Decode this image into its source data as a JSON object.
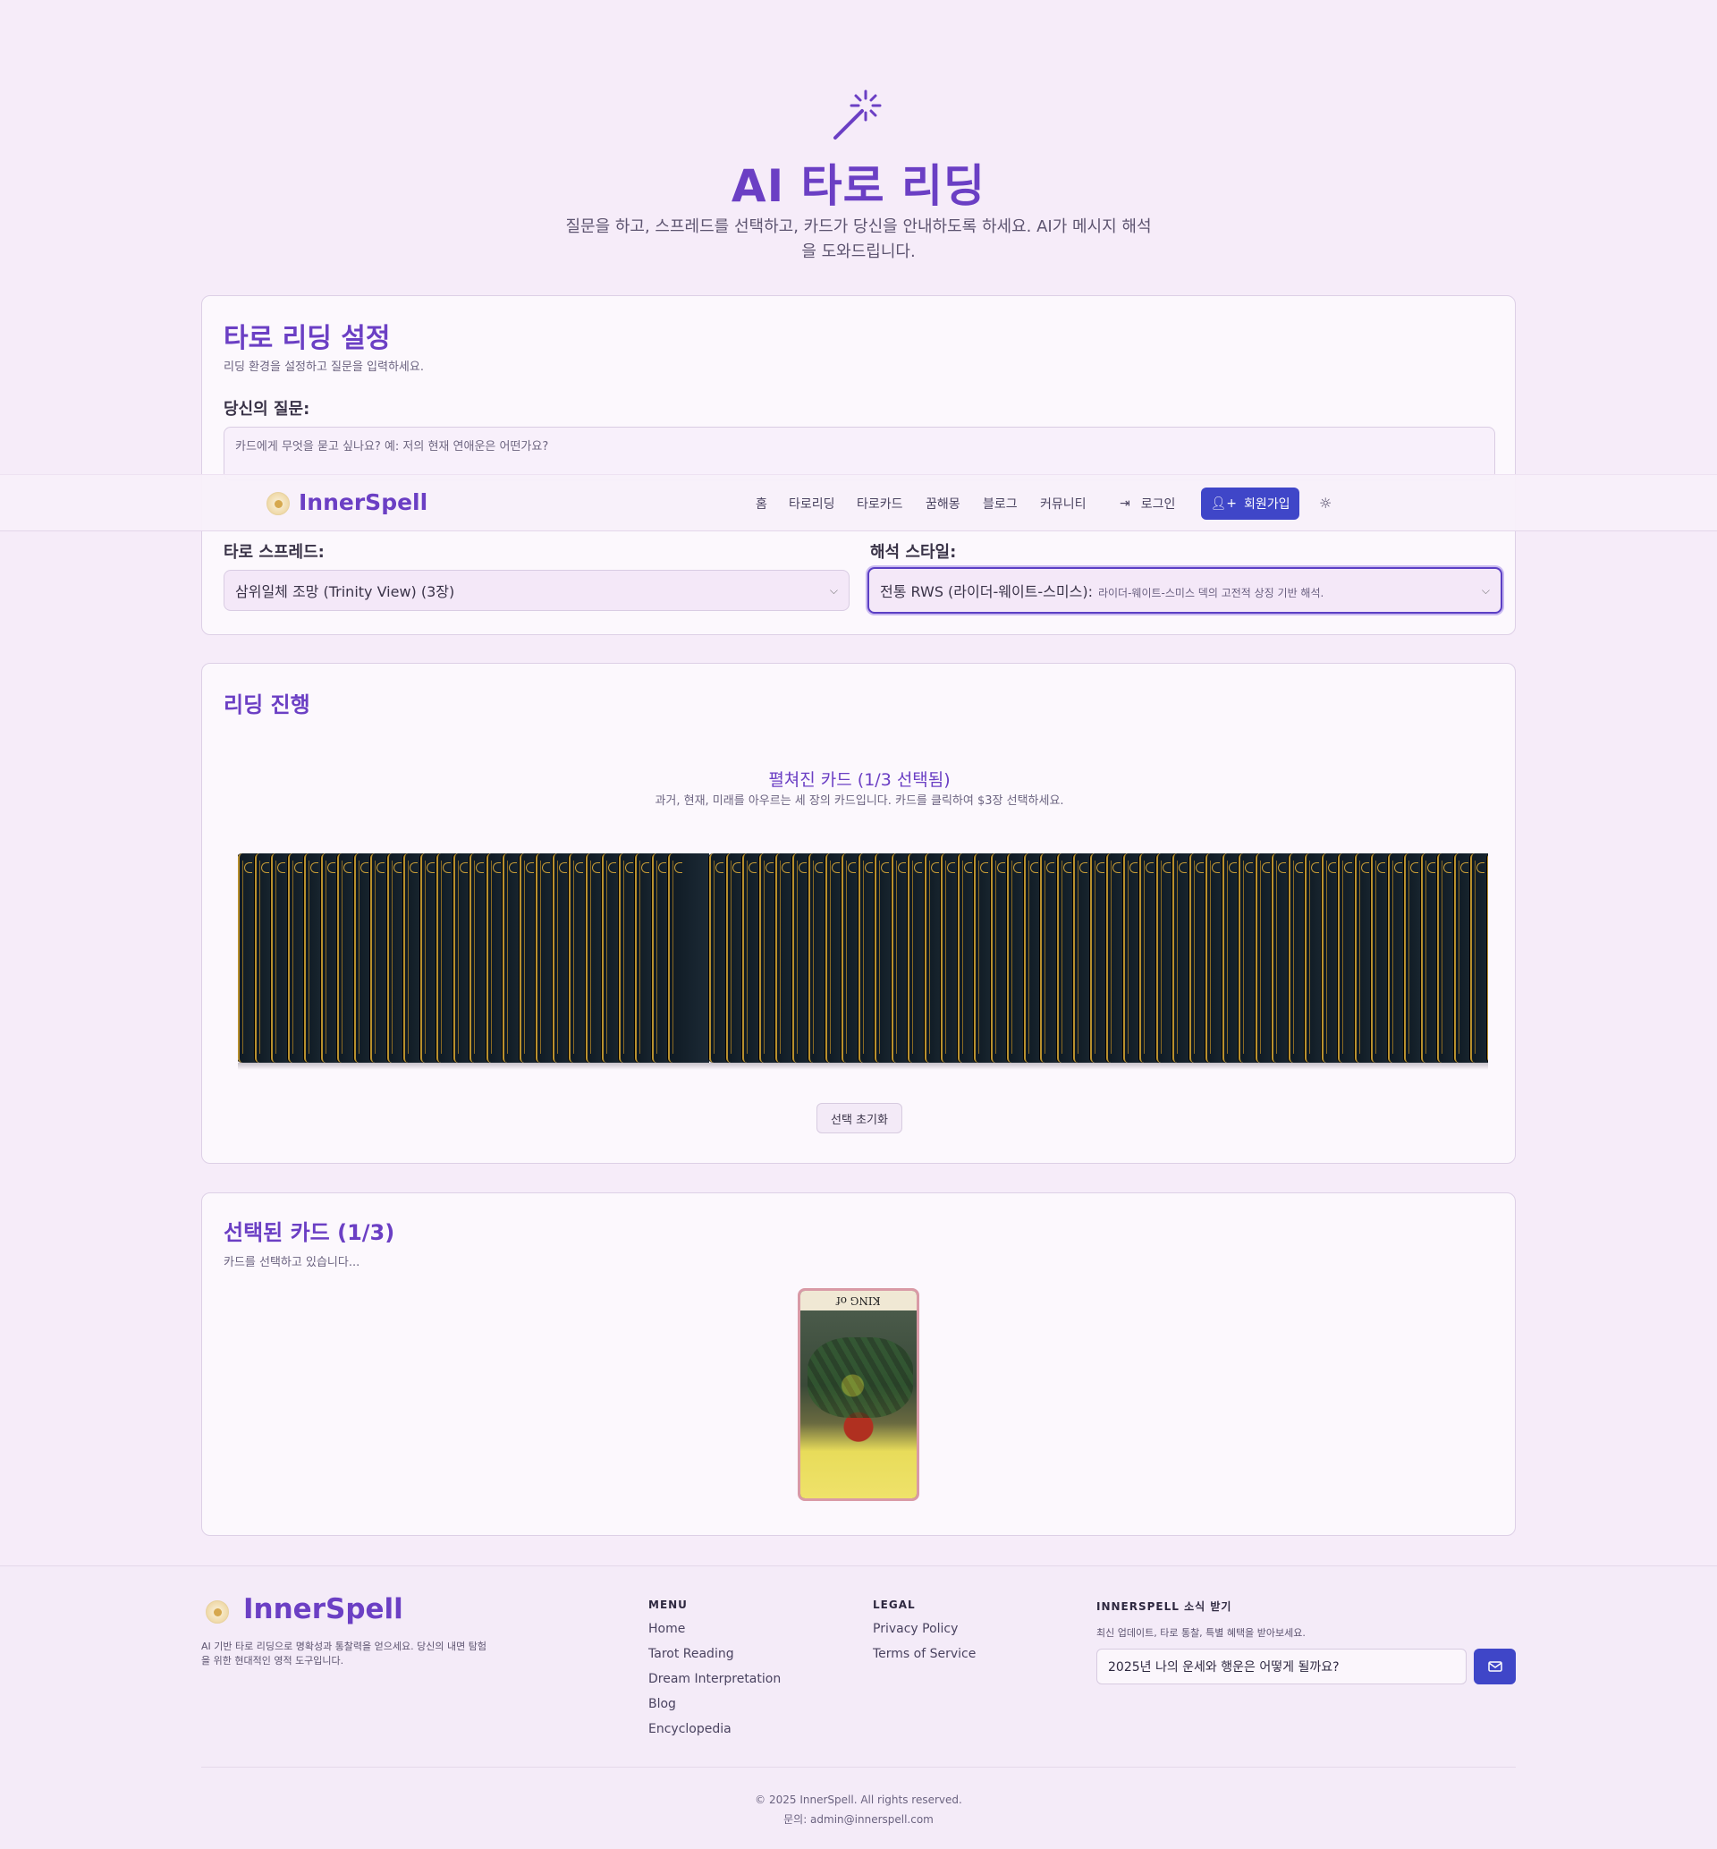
{
  "hero": {
    "title_ai": "AI",
    "title_rest": " 타로 리딩",
    "subtitle_line1": "질문을 하고, 스프레드를 선택하고, 카드가 당신을 안내하도록 하세요. AI가 메시지 해석",
    "subtitle_line2": "을 도와드립니다."
  },
  "settings": {
    "title": "타로 리딩 설정",
    "desc": "리딩 환경을 설정하고 질문을 입력하세요.",
    "question_label": "당신의 질문:",
    "question_placeholder": "카드에게 무엇을 묻고 싶나요? 예: 저의 현재 연애운은 어떤가요?",
    "spread_label": "타로 스프레드:",
    "spread_value": "삼위일체 조망 (Trinity View) (3장)",
    "style_label": "해석 스타일:",
    "style_value": "전통 RWS (라이더-웨이트-스미스):",
    "style_desc": "라이더-웨이트-스미스 덱의 고전적 상징 기반 해석."
  },
  "navbar": {
    "brand": "InnerSpell",
    "items": [
      "홈",
      "타로리딩",
      "타로카드",
      "꿈해몽",
      "블로그",
      "커뮤니티"
    ],
    "login": "로그인",
    "signup": "회원가입"
  },
  "progress": {
    "title": "리딩 진행",
    "deck_title": "펼쳐진 카드 (1/3 선택됨)",
    "deck_sub": "과거, 현재, 미래를 아우르는 세 장의 카드입니다. 카드를 클릭하여 $3장 선택하세요.",
    "reset": "선택 초기화"
  },
  "selected": {
    "title": "선택된 카드 (1/3)",
    "desc": "카드를 선택하고 있습니다...",
    "card_name": "KING of PENTACLES"
  },
  "footer": {
    "brand": "InnerSpell",
    "desc": "AI 기반 타로 리딩으로 명확성과 통찰력을 얻으세요. 당신의 내면 탐험을 위한 현대적인 영적 도구입니다.",
    "menu_head": "MENU",
    "menu": [
      "Home",
      "Tarot Reading",
      "Dream Interpretation",
      "Blog",
      "Encyclopedia"
    ],
    "legal_head": "LEGAL",
    "legal": [
      "Privacy Policy",
      "Terms of Service"
    ],
    "news_head": "INNERSPELL 소식 받기",
    "news_sub": "최신 업데이트, 타로 통찰, 특별 혜택을 받아보세요.",
    "news_input": "2025년 나의 운세와 행운은 어떻게 될까요?",
    "copyright": "© 2025 InnerSpell. All rights reserved.",
    "contact": "문의: admin@innerspell.com"
  },
  "colors": {
    "accent": "#6b3fc4",
    "button": "#3f46c8",
    "background": "#f6ecf9"
  }
}
